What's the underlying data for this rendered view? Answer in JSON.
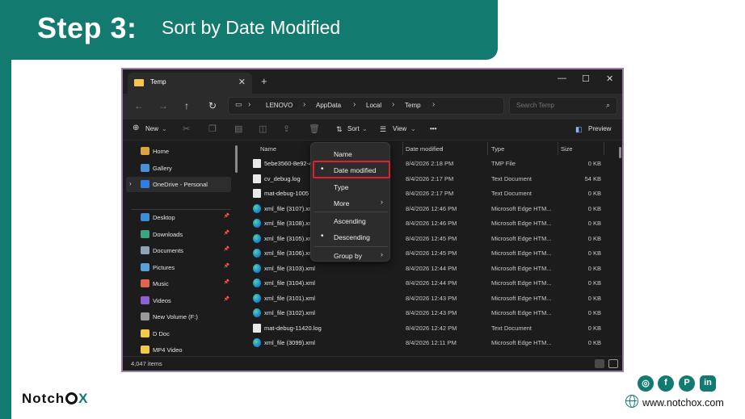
{
  "banner": {
    "step": "Step 3:",
    "description": "Sort by Date Modified"
  },
  "window": {
    "tab_title": "Temp",
    "tab_close": "✕",
    "new_tab": "+",
    "controls": {
      "minimize": "—",
      "maximize": "☐",
      "close": "✕"
    },
    "nav": {
      "back": "←",
      "forward": "→",
      "up": "↑",
      "refresh": "↻"
    },
    "breadcrumb": [
      "LENOVO",
      "AppData",
      "Local",
      "Temp"
    ],
    "search_placeholder": "Search Temp",
    "toolbar": {
      "new_label": "New",
      "sort_label": "Sort",
      "view_label": "View",
      "more": "•••",
      "preview_label": "Preview"
    },
    "sidebar": [
      {
        "label": "Home",
        "color": "#d9a441",
        "pinned": false
      },
      {
        "label": "Gallery",
        "color": "#4a90d9",
        "pinned": false
      },
      {
        "label": "OneDrive - Personal",
        "color": "#2f7fe0",
        "pinned": false,
        "selected": true,
        "expand": "›"
      },
      {
        "label": "Desktop",
        "color": "#3c8fd6",
        "pinned": true
      },
      {
        "label": "Downloads",
        "color": "#3aa57c",
        "pinned": true
      },
      {
        "label": "Documents",
        "color": "#8fa3b8",
        "pinned": true
      },
      {
        "label": "Pictures",
        "color": "#5aa0d8",
        "pinned": true
      },
      {
        "label": "Music",
        "color": "#e0654f",
        "pinned": true
      },
      {
        "label": "Videos",
        "color": "#8b62d6",
        "pinned": true
      },
      {
        "label": "New Volume (F:)",
        "color": "#9a9a9a",
        "pinned": false
      },
      {
        "label": "D Doc",
        "color": "#f2c94c",
        "pinned": false
      },
      {
        "label": "MP4 Video",
        "color": "#f2c94c",
        "pinned": false
      }
    ],
    "columns": {
      "name": "Name",
      "date": "Date modified",
      "type": "Type",
      "size": "Size"
    },
    "files": [
      {
        "name": "5ebe3560-8e92-4",
        "date": "8/4/2026 2:18 PM",
        "type": "TMP File",
        "size": "0 KB",
        "icon": "doc"
      },
      {
        "name": "cv_debug.log",
        "date": "8/4/2026 2:17 PM",
        "type": "Text Document",
        "size": "54 KB",
        "icon": "doc"
      },
      {
        "name": "mat-debug-1005",
        "date": "8/4/2026 2:17 PM",
        "type": "Text Document",
        "size": "0 KB",
        "icon": "doc"
      },
      {
        "name": "xml_file (3107).xm",
        "date": "8/4/2026 12:46 PM",
        "type": "Microsoft Edge HTM...",
        "size": "0 KB",
        "icon": "edge"
      },
      {
        "name": "xml_file (3108).xm",
        "date": "8/4/2026 12:46 PM",
        "type": "Microsoft Edge HTM...",
        "size": "0 KB",
        "icon": "edge"
      },
      {
        "name": "xml_file (3105).xm",
        "date": "8/4/2026 12:45 PM",
        "type": "Microsoft Edge HTM...",
        "size": "0 KB",
        "icon": "edge"
      },
      {
        "name": "xml_file (3106).xm",
        "date": "8/4/2026 12:45 PM",
        "type": "Microsoft Edge HTM...",
        "size": "0 KB",
        "icon": "edge"
      },
      {
        "name": "xml_file (3103).xml",
        "date": "8/4/2026 12:44 PM",
        "type": "Microsoft Edge HTM...",
        "size": "0 KB",
        "icon": "edge"
      },
      {
        "name": "xml_file (3104).xml",
        "date": "8/4/2026 12:44 PM",
        "type": "Microsoft Edge HTM...",
        "size": "0 KB",
        "icon": "edge"
      },
      {
        "name": "xml_file (3101).xml",
        "date": "8/4/2026 12:43 PM",
        "type": "Microsoft Edge HTM...",
        "size": "0 KB",
        "icon": "edge"
      },
      {
        "name": "xml_file (3102).xml",
        "date": "8/4/2026 12:43 PM",
        "type": "Microsoft Edge HTM...",
        "size": "0 KB",
        "icon": "edge"
      },
      {
        "name": "mat-debug-11420.log",
        "date": "8/4/2026 12:42 PM",
        "type": "Text Document",
        "size": "0 KB",
        "icon": "doc"
      },
      {
        "name": "xml_file (3099).xml",
        "date": "8/4/2026 12:11 PM",
        "type": "Microsoft Edge HTM...",
        "size": "0 KB",
        "icon": "edge"
      }
    ],
    "status_count": "4,047 items",
    "sort_menu": {
      "items": [
        {
          "label": "Name",
          "checked": false,
          "submenu": false
        },
        {
          "label": "Date modified",
          "checked": true,
          "submenu": false
        },
        {
          "label": "Type",
          "checked": false,
          "submenu": false
        },
        {
          "label": "More",
          "checked": false,
          "submenu": true
        },
        {
          "label": "Ascending",
          "checked": false,
          "submenu": false
        },
        {
          "label": "Descending",
          "checked": true,
          "submenu": false
        },
        {
          "label": "Group by",
          "checked": false,
          "submenu": true
        }
      ]
    }
  },
  "footer": {
    "logo_left": "Notch",
    "logo_right": "X",
    "website": "www.notchox.com",
    "social": [
      {
        "name": "instagram-icon",
        "glyph": "◎",
        "color": "#127a6f"
      },
      {
        "name": "facebook-icon",
        "glyph": "f",
        "color": "#127a6f"
      },
      {
        "name": "pinterest-icon",
        "glyph": "P",
        "color": "#127a6f"
      },
      {
        "name": "linkedin-icon",
        "glyph": "in",
        "color": "#127a6f"
      }
    ]
  },
  "colors": {
    "brand": "#127a6f",
    "highlight": "#e0202b",
    "window_bg": "#1c1c1c"
  }
}
